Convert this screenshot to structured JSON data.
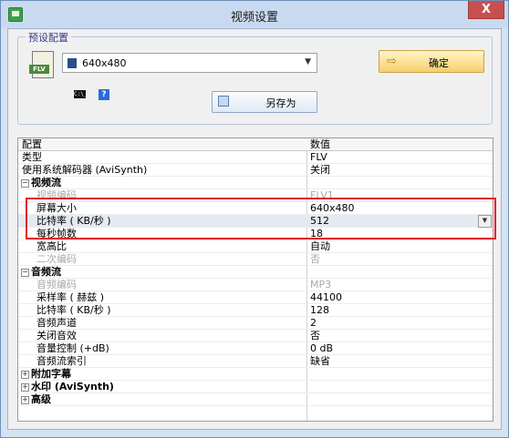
{
  "window": {
    "title": "视频设置",
    "close_glyph": "X"
  },
  "preset": {
    "group_label": "预设配置",
    "selected": "640x480",
    "ok_label": "确定",
    "saveas_label": "另存为",
    "flv_label": "FLV",
    "cmd_label": "C:\\_",
    "help_label": "?"
  },
  "grid": {
    "col_name": "配置",
    "col_value": "数值",
    "rows": [
      {
        "name": "类型",
        "value": "FLV"
      },
      {
        "name": "使用系统解码器 (AviSynth)",
        "value": "关闭"
      },
      {
        "name": "视频流",
        "value": ""
      },
      {
        "name": "视频编码",
        "value": "FLV1"
      },
      {
        "name": "屏幕大小",
        "value": "640x480"
      },
      {
        "name": "比特率 ( KB/秒 )",
        "value": "512"
      },
      {
        "name": "每秒帧数",
        "value": "18"
      },
      {
        "name": "宽高比",
        "value": "自动"
      },
      {
        "name": "二次编码",
        "value": "否"
      },
      {
        "name": "音频流",
        "value": ""
      },
      {
        "name": "音频编码",
        "value": "MP3"
      },
      {
        "name": "采样率 ( 赫兹 )",
        "value": "44100"
      },
      {
        "name": "比特率 ( KB/秒 )",
        "value": "128"
      },
      {
        "name": "音频声道",
        "value": "2"
      },
      {
        "name": "关闭音效",
        "value": "否"
      },
      {
        "name": "音量控制 (+dB)",
        "value": "0 dB"
      },
      {
        "name": "音频流索引",
        "value": "缺省"
      },
      {
        "name": "附加字幕",
        "value": ""
      },
      {
        "name": "水印 (AviSynth)",
        "value": ""
      },
      {
        "name": "高级",
        "value": ""
      }
    ],
    "collapse_glyph": "−",
    "expand_glyph": "+",
    "dropdown_glyph": "▼"
  },
  "colors": {
    "highlight": "#e0202a",
    "accent": "#f7cf6a"
  }
}
